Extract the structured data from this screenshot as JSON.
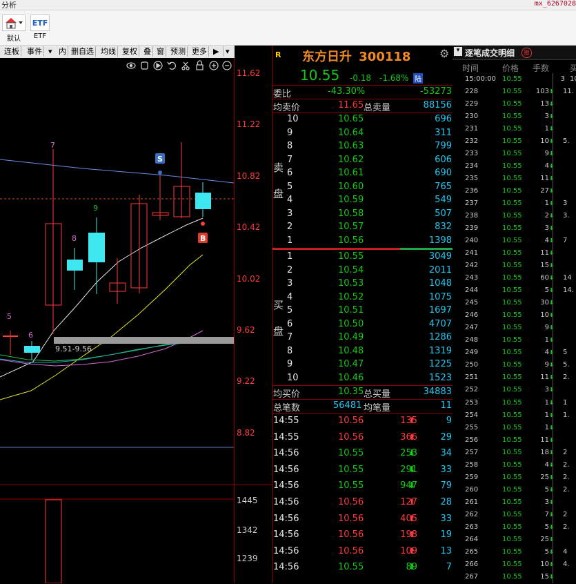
{
  "window": {
    "title": "分析",
    "user": "mx_6267028"
  },
  "toolbar": {
    "default_label": "默认",
    "etf_icon_text": "ETF",
    "etf_label": "ETF"
  },
  "chart_toolbar": {
    "items": [
      "连板",
      "事件",
      "内",
      "删自选",
      "均线",
      "复权",
      "叠",
      "窗",
      "预测",
      "更多"
    ]
  },
  "kline_chart": {
    "price_axis": [
      "11.62",
      "11.22",
      "10.82",
      "10.42",
      "10.02",
      "9.62",
      "9.22",
      "8.82"
    ],
    "volume_axis": [
      "1445",
      "1342",
      "1239"
    ],
    "markers": {
      "sell": "S",
      "buy": "B"
    },
    "range_label": "9.51-9.56",
    "counters": [
      "5",
      "6",
      "7",
      "8",
      "9"
    ]
  },
  "quote": {
    "tag": "R",
    "name": "东方日升",
    "code": "300118",
    "price": "10.55",
    "change": "-0.18",
    "change_pct": "-1.68%",
    "badge": "陆",
    "weibi_label": "委比",
    "weibi_pct": "-43.30%",
    "weibi_val": "-53273",
    "avg_sell_label": "均卖价",
    "avg_sell_price": "11.65",
    "total_sell_label": "总卖量",
    "total_sell_volume": "88156",
    "sell_label_1": "卖",
    "sell_label_2": "盘",
    "sells": [
      {
        "level": "10",
        "price": "10.65",
        "vol": "696"
      },
      {
        "level": "9",
        "price": "10.64",
        "vol": "311"
      },
      {
        "level": "8",
        "price": "10.63",
        "vol": "799"
      },
      {
        "level": "7",
        "price": "10.62",
        "vol": "606"
      },
      {
        "level": "6",
        "price": "10.61",
        "vol": "690"
      },
      {
        "level": "5",
        "price": "10.60",
        "vol": "765"
      },
      {
        "level": "4",
        "price": "10.59",
        "vol": "549"
      },
      {
        "level": "3",
        "price": "10.58",
        "vol": "507"
      },
      {
        "level": "2",
        "price": "10.57",
        "vol": "832"
      },
      {
        "level": "1",
        "price": "10.56",
        "vol": "1398"
      }
    ],
    "buy_label_1": "买",
    "buy_label_2": "盘",
    "buys": [
      {
        "level": "1",
        "price": "10.55",
        "vol": "3049"
      },
      {
        "level": "2",
        "price": "10.54",
        "vol": "2011"
      },
      {
        "level": "3",
        "price": "10.53",
        "vol": "1048"
      },
      {
        "level": "4",
        "price": "10.52",
        "vol": "1075"
      },
      {
        "level": "5",
        "price": "10.51",
        "vol": "1697"
      },
      {
        "level": "6",
        "price": "10.50",
        "vol": "4707"
      },
      {
        "level": "7",
        "price": "10.49",
        "vol": "1286"
      },
      {
        "level": "8",
        "price": "10.48",
        "vol": "1319"
      },
      {
        "level": "9",
        "price": "10.47",
        "vol": "1225"
      },
      {
        "level": "10",
        "price": "10.46",
        "vol": "1523"
      }
    ],
    "avg_buy_label": "均买价",
    "avg_buy_price": "10.35",
    "total_buy_label": "总买量",
    "total_buy_volume": "34883",
    "total_trades_label": "总笔数",
    "total_trades": "56481",
    "avg_trade_label": "均笔量",
    "avg_trade": "11",
    "ticks": [
      {
        "time": "14:55",
        "price": "10.56",
        "vol": "135",
        "dir": "up",
        "count": "9"
      },
      {
        "time": "14:55",
        "price": "10.56",
        "vol": "366",
        "dir": "up",
        "count": "29"
      },
      {
        "time": "14:56",
        "price": "10.55",
        "vol": "253",
        "dir": "down",
        "count": "34"
      },
      {
        "time": "14:56",
        "price": "10.55",
        "vol": "291",
        "dir": "down",
        "count": "33"
      },
      {
        "time": "14:56",
        "price": "10.55",
        "vol": "947",
        "dir": "down",
        "count": "79"
      },
      {
        "time": "14:56",
        "price": "10.56",
        "vol": "127",
        "dir": "up",
        "count": "28"
      },
      {
        "time": "14:56",
        "price": "10.56",
        "vol": "405",
        "dir": "up",
        "count": "33"
      },
      {
        "time": "14:56",
        "price": "10.56",
        "vol": "198",
        "dir": "up",
        "count": "19"
      },
      {
        "time": "14:56",
        "price": "10.56",
        "vol": "109",
        "dir": "up",
        "count": "13"
      },
      {
        "time": "14:56",
        "price": "10.55",
        "vol": "89",
        "dir": "down",
        "count": "7"
      }
    ]
  },
  "trades": {
    "title": "逐笔成交明细",
    "col_time": "时间",
    "col_price": "价格",
    "col_vol": "手数",
    "col_extra": "买",
    "first_row": {
      "time": "15:00:00",
      "price": "10.55",
      "vol": "3",
      "extra": "10"
    },
    "rows": [
      {
        "n": "228",
        "price": "10.55",
        "vol": "103",
        "dir": "down",
        "extra": "11."
      },
      {
        "n": "229",
        "price": "10.55",
        "vol": "13",
        "dir": "down",
        "extra": ""
      },
      {
        "n": "230",
        "price": "10.55",
        "vol": "3",
        "dir": "down",
        "extra": ""
      },
      {
        "n": "231",
        "price": "10.55",
        "vol": "1",
        "dir": "down",
        "extra": ""
      },
      {
        "n": "232",
        "price": "10.55",
        "vol": "10",
        "dir": "down",
        "extra": "5."
      },
      {
        "n": "233",
        "price": "10.55",
        "vol": "9",
        "dir": "down",
        "extra": ""
      },
      {
        "n": "234",
        "price": "10.55",
        "vol": "4",
        "dir": "down",
        "extra": ""
      },
      {
        "n": "235",
        "price": "10.55",
        "vol": "11",
        "dir": "down",
        "extra": ""
      },
      {
        "n": "236",
        "price": "10.55",
        "vol": "27",
        "dir": "down",
        "extra": ""
      },
      {
        "n": "237",
        "price": "10.55",
        "vol": "1",
        "dir": "down",
        "extra": "3"
      },
      {
        "n": "238",
        "price": "10.55",
        "vol": "2",
        "dir": "down",
        "extra": "3."
      },
      {
        "n": "239",
        "price": "10.55",
        "vol": "3",
        "dir": "down",
        "extra": ""
      },
      {
        "n": "240",
        "price": "10.55",
        "vol": "4",
        "dir": "down",
        "extra": "7"
      },
      {
        "n": "241",
        "price": "10.55",
        "vol": "11",
        "dir": "down",
        "extra": ""
      },
      {
        "n": "242",
        "price": "10.55",
        "vol": "15",
        "dir": "down",
        "extra": ""
      },
      {
        "n": "243",
        "price": "10.55",
        "vol": "60",
        "dir": "down",
        "extra": "14"
      },
      {
        "n": "244",
        "price": "10.55",
        "vol": "5",
        "dir": "down",
        "extra": "14."
      },
      {
        "n": "245",
        "price": "10.55",
        "vol": "30",
        "dir": "down",
        "extra": ""
      },
      {
        "n": "246",
        "price": "10.55",
        "vol": "10",
        "dir": "down",
        "extra": ""
      },
      {
        "n": "247",
        "price": "10.55",
        "vol": "9",
        "dir": "down",
        "extra": ""
      },
      {
        "n": "248",
        "price": "10.55",
        "vol": "1",
        "dir": "down",
        "extra": ""
      },
      {
        "n": "249",
        "price": "10.55",
        "vol": "4",
        "dir": "down",
        "extra": "5"
      },
      {
        "n": "250",
        "price": "10.55",
        "vol": "9",
        "dir": "down",
        "extra": "5."
      },
      {
        "n": "251",
        "price": "10.55",
        "vol": "11",
        "dir": "down",
        "extra": "2."
      },
      {
        "n": "252",
        "price": "10.55",
        "vol": "3",
        "dir": "down",
        "extra": ""
      },
      {
        "n": "253",
        "price": "10.55",
        "vol": "1",
        "dir": "down",
        "extra": "1"
      },
      {
        "n": "254",
        "price": "10.55",
        "vol": "1",
        "dir": "down",
        "extra": "1."
      },
      {
        "n": "255",
        "price": "10.55",
        "vol": "1",
        "dir": "down",
        "extra": ""
      },
      {
        "n": "256",
        "price": "10.55",
        "vol": "11",
        "dir": "down",
        "extra": ""
      },
      {
        "n": "257",
        "price": "10.55",
        "vol": "18",
        "dir": "down",
        "extra": "2"
      },
      {
        "n": "258",
        "price": "10.55",
        "vol": "4",
        "dir": "down",
        "extra": "2."
      },
      {
        "n": "259",
        "price": "10.55",
        "vol": "25",
        "dir": "down",
        "extra": "2."
      },
      {
        "n": "260",
        "price": "10.55",
        "vol": "5",
        "dir": "down",
        "extra": "2."
      },
      {
        "n": "261",
        "price": "10.55",
        "vol": "3",
        "dir": "down",
        "extra": ""
      },
      {
        "n": "262",
        "price": "10.55",
        "vol": "7",
        "dir": "down",
        "extra": "2"
      },
      {
        "n": "263",
        "price": "10.55",
        "vol": "5",
        "dir": "down",
        "extra": "2."
      },
      {
        "n": "264",
        "price": "10.55",
        "vol": "25",
        "dir": "down",
        "extra": ""
      },
      {
        "n": "265",
        "price": "10.55",
        "vol": "5",
        "dir": "down",
        "extra": "4"
      },
      {
        "n": "266",
        "price": "10.55",
        "vol": "10",
        "dir": "down",
        "extra": "4."
      },
      {
        "n": "267",
        "price": "10.55",
        "vol": "15",
        "dir": "down",
        "extra": ""
      }
    ]
  }
}
